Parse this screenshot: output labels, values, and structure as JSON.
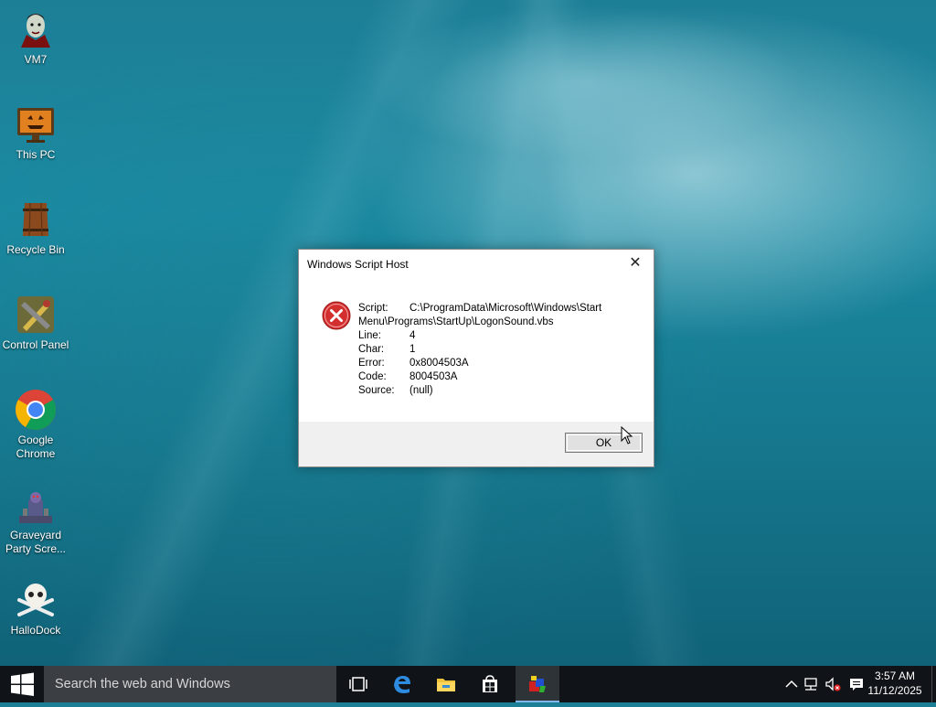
{
  "desktop": {
    "icons": [
      {
        "label": "VM7",
        "icon": "vampire-avatar-icon"
      },
      {
        "label": "This PC",
        "icon": "pumpkin-monitor-icon"
      },
      {
        "label": "Recycle Bin",
        "icon": "wooden-barrel-icon"
      },
      {
        "label": "Control Panel",
        "icon": "tools-icon"
      },
      {
        "label": "Google Chrome",
        "icon": "chrome-icon"
      },
      {
        "label": "Graveyard Party Scre...",
        "icon": "graveyard-ghoul-icon"
      },
      {
        "label": "HalloDock",
        "icon": "skull-crossbones-icon"
      }
    ]
  },
  "dialog": {
    "title": "Windows Script Host",
    "close_glyph": "✕",
    "icon": "error-icon",
    "fields": [
      {
        "key": "Script:",
        "value": "C:\\ProgramData\\Microsoft\\Windows\\Start"
      },
      {
        "key": "",
        "value": "Menu\\Programs\\StartUp\\LogonSound.vbs"
      },
      {
        "key": "Line:",
        "value": "4"
      },
      {
        "key": "Char:",
        "value": "1"
      },
      {
        "key": "Error:",
        "value": "0x8004503A"
      },
      {
        "key": "Code:",
        "value": "8004503A"
      },
      {
        "key": "Source:",
        "value": "(null)"
      }
    ],
    "ok_label": "OK"
  },
  "taskbar": {
    "search_placeholder": "Search the web and Windows",
    "pinned": [
      "task-view-icon",
      "edge-icon",
      "file-explorer-icon",
      "store-icon",
      "script-host-icon"
    ],
    "tray": [
      "chevron-up-icon",
      "network-icon",
      "volume-muted-icon",
      "action-center-icon"
    ],
    "clock": {
      "time": "3:57 AM",
      "date": "11/12/2025"
    }
  },
  "colors": {
    "taskbar": "#101418",
    "search_box": "#3b3f43",
    "error_red": "#d32f2f",
    "active_underline": "#7fb8e8"
  }
}
